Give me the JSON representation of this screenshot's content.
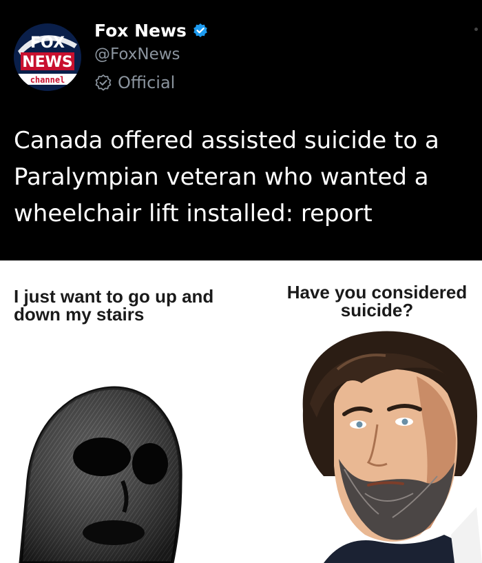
{
  "tweet": {
    "avatar": {
      "line1": "FOX",
      "line2": "NEWS",
      "line3": "channel",
      "colors": {
        "background": "#0a1f4a",
        "red": "#c8102e",
        "white": "#ffffff"
      }
    },
    "display_name": "Fox News",
    "verified_icon": "verified-badge-icon",
    "handle": "@FoxNews",
    "official_label": "Official",
    "text": "Canada offered assisted suicide to a Paralympian veteran who wanted a wheelchair lift installed: report",
    "colors": {
      "background": "#000000",
      "text": "#ffffff",
      "muted": "#8b949e",
      "badge": "#1d9bf0"
    }
  },
  "meme": {
    "left_caption": "I just want to go up and down my stairs",
    "right_caption": "Have you considered suicide?",
    "left_figure": "wojak-figure",
    "right_figure": "bearded-man-figure"
  }
}
